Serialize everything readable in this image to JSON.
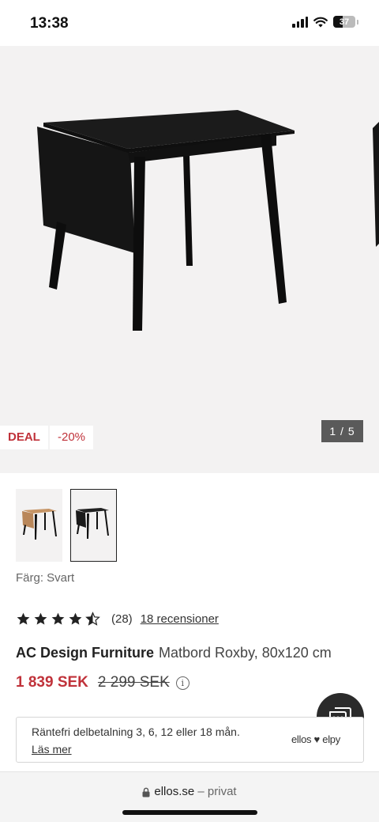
{
  "status": {
    "time": "13:38",
    "battery": "37"
  },
  "gallery": {
    "badges": {
      "deal": "DEAL",
      "discount": "-20%"
    },
    "counter": "1 / 5"
  },
  "thumbnails": [
    {
      "name": "thumb-natural",
      "active": false
    },
    {
      "name": "thumb-black",
      "active": true
    }
  ],
  "product": {
    "color_label": "Färg: Svart",
    "rating": {
      "value": 4.5,
      "out_of": 5,
      "count": "(28)",
      "reviews_link": "18 recensioner"
    },
    "brand": "AC Design Furniture",
    "name": "Matbord Roxby, 80x120 cm",
    "price_now": "1 839 SEK",
    "price_old": "2 299 SEK",
    "info_icon": "i"
  },
  "payment": {
    "text": "Räntefri delbetalning 3, 6, 12 eller 18 mån.",
    "link": "Läs mer",
    "logo": "ellos ♥ elpy"
  },
  "browser": {
    "url": "ellos.se",
    "private": "– privat"
  },
  "colors": {
    "accent": "#c0323a",
    "dark": "#2b2b2b",
    "hero_bg": "#f3f2f2"
  }
}
